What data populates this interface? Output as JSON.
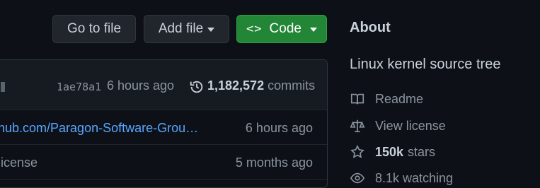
{
  "toolbar": {
    "go_to_file": "Go to file",
    "add_file": "Add file",
    "code": "Code"
  },
  "latest_commit": {
    "sha": "1ae78a1",
    "time": "6 hours ago",
    "commit_count": "1,182,572",
    "commits_label": "commits"
  },
  "files": [
    {
      "message": "hub.com/Paragon-Software-Grou…",
      "time": "6 hours ago"
    },
    {
      "message": "license",
      "time": "5 months ago"
    }
  ],
  "about": {
    "title": "About",
    "description": "Linux kernel source tree",
    "readme": "Readme",
    "license": "View license",
    "stars_count": "150k",
    "stars_label": "stars",
    "watching": "8.1k watching"
  },
  "colors": {
    "background": "#0d1117",
    "button_bg": "#21262d",
    "code_button": "#238636",
    "link": "#58a6ff",
    "muted": "#8b949e"
  },
  "icons": [
    "caret-down-icon",
    "code-icon",
    "history-icon",
    "book-icon",
    "scale-icon",
    "star-icon",
    "eye-icon"
  ]
}
